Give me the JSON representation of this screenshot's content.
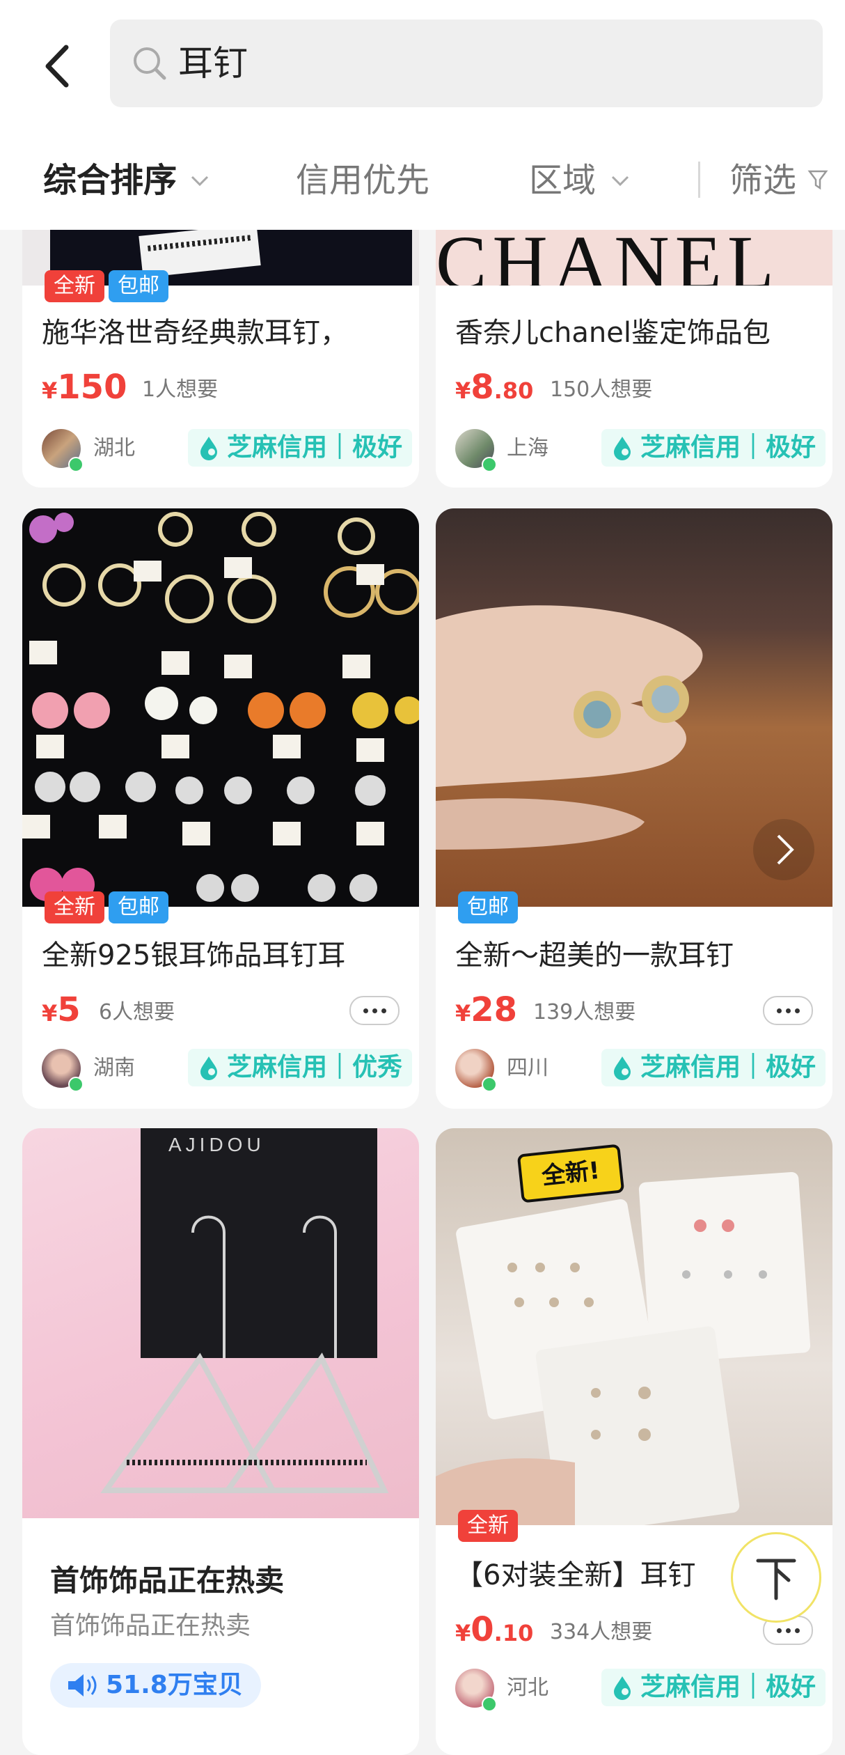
{
  "header": {
    "search_query": "耳钉",
    "sort_tabs": [
      "综合排序",
      "信用优先",
      "区域",
      "筛选"
    ]
  },
  "cards": [
    {
      "title": "施华洛世奇经典款耳钉，",
      "tags": [
        "全新",
        "包邮"
      ],
      "price_int": "150",
      "price_dec": "",
      "wants": "1人想要",
      "region": "湖北",
      "credit": "芝麻信用｜极好"
    },
    {
      "title": "香奈儿chanel鉴定饰品包",
      "tags": [],
      "image_text": "CHANEL",
      "price_int": "8",
      "price_dec": ".80",
      "wants": "150人想要",
      "region": "上海",
      "credit": "芝麻信用｜极好"
    },
    {
      "title": "全新925银耳饰品耳钉耳",
      "tags": [
        "全新",
        "包邮"
      ],
      "price_int": "5",
      "price_dec": "",
      "wants": "6人想要",
      "region": "湖南",
      "credit": "芝麻信用｜优秀"
    },
    {
      "title": "全新～超美的一款耳钉",
      "tags": [
        "包邮"
      ],
      "price_int": "28",
      "price_dec": "",
      "wants": "139人想要",
      "region": "四川",
      "credit": "芝麻信用｜极好"
    },
    {
      "title": "首饰饰品正在热卖",
      "subtitle": "首饰饰品正在热卖",
      "image_text": "AJIDOU",
      "promo": "51.8万宝贝"
    },
    {
      "title": "【6对装全新】耳钉",
      "tags": [
        "全新"
      ],
      "image_text": "全新!",
      "price_int": "0",
      "price_dec": ".10",
      "wants": "334人想要",
      "region": "河北",
      "credit": "芝麻信用｜极好"
    }
  ],
  "currency": "¥",
  "colors": {
    "price": "#f0413a",
    "credit": "#26c1b4",
    "tag_new": "#f0413a",
    "tag_ship": "#2f9ef0"
  }
}
